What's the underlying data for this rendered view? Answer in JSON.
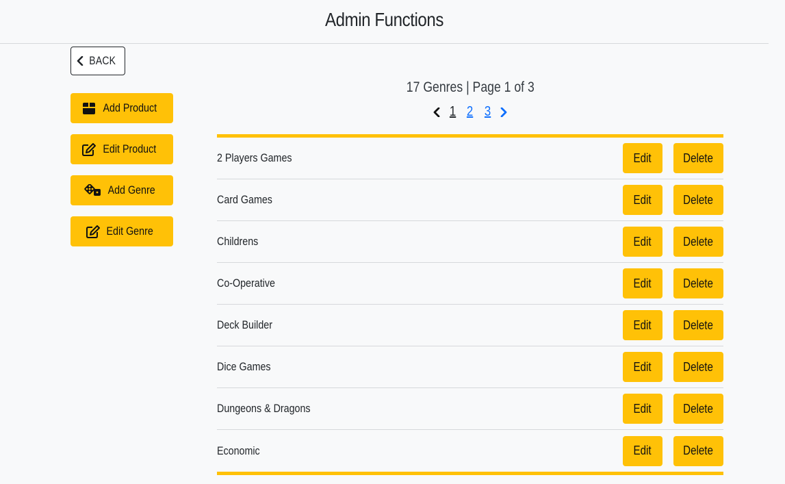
{
  "header": {
    "title": "Admin Functions"
  },
  "back": {
    "label": "BACK"
  },
  "sidebar": {
    "items": [
      {
        "label": "Add Product",
        "icon": "box-icon"
      },
      {
        "label": "Edit Product",
        "icon": "edit-icon"
      },
      {
        "label": "Add Genre",
        "icon": "dice-icon"
      },
      {
        "label": "Edit Genre",
        "icon": "edit-icon"
      }
    ]
  },
  "summary": {
    "text": "17 Genres | Page 1 of 3"
  },
  "pagination": {
    "pages": [
      "1",
      "2",
      "3"
    ],
    "current": "1"
  },
  "genres": [
    {
      "name": "2 Players Games",
      "edit": "Edit",
      "delete": "Delete"
    },
    {
      "name": "Card Games",
      "edit": "Edit",
      "delete": "Delete"
    },
    {
      "name": "Childrens",
      "edit": "Edit",
      "delete": "Delete"
    },
    {
      "name": "Co-Operative",
      "edit": "Edit",
      "delete": "Delete"
    },
    {
      "name": "Deck Builder",
      "edit": "Edit",
      "delete": "Delete"
    },
    {
      "name": "Dice Games",
      "edit": "Edit",
      "delete": "Delete"
    },
    {
      "name": "Dungeons & Dragons",
      "edit": "Edit",
      "delete": "Delete"
    },
    {
      "name": "Economic",
      "edit": "Edit",
      "delete": "Delete"
    }
  ],
  "colors": {
    "accent": "#ffc107",
    "link": "#0d6efd",
    "background": "#f8f9fa"
  }
}
